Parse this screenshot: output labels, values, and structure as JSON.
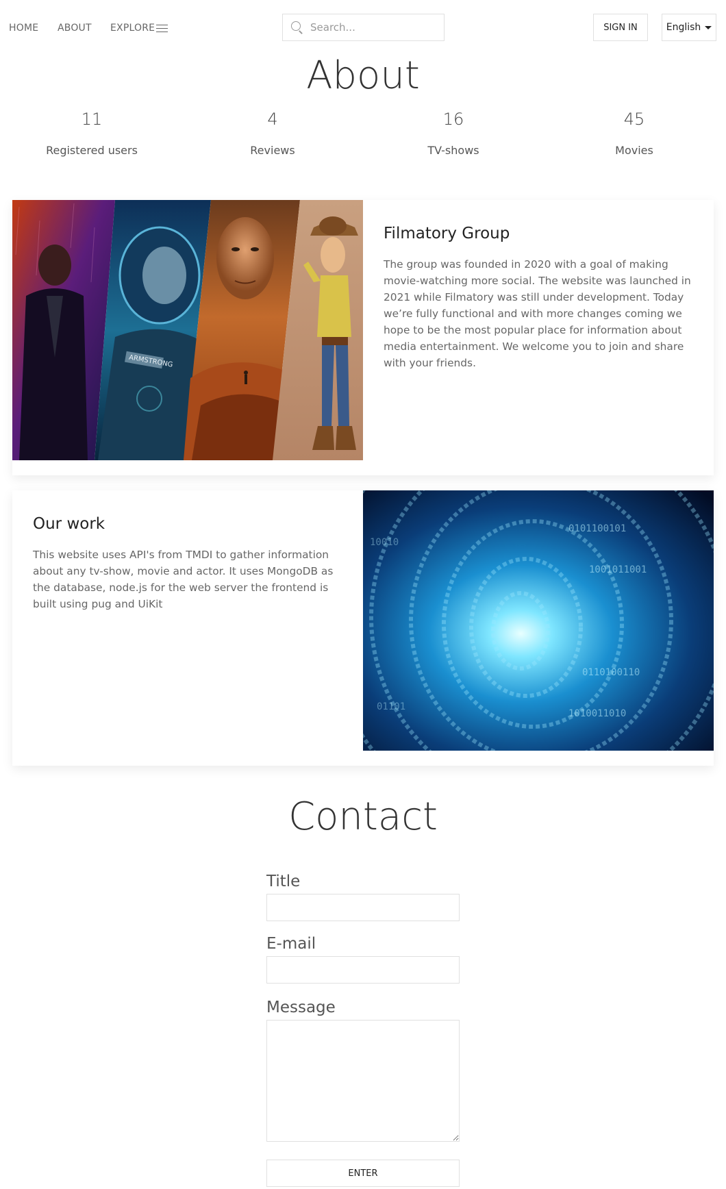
{
  "nav": {
    "home": "HOME",
    "about": "ABOUT",
    "explore": "EXPLORE",
    "search_placeholder": "Search...",
    "signin": "SIGN IN",
    "language": "English"
  },
  "about": {
    "title": "About",
    "stats": [
      {
        "value": "11",
        "label": "Registered users"
      },
      {
        "value": "4",
        "label": "Reviews"
      },
      {
        "value": "16",
        "label": "TV-shows"
      },
      {
        "value": "45",
        "label": "Movies"
      }
    ]
  },
  "cards": [
    {
      "title": "Filmatory Group",
      "body": "The group was founded in 2020 with a goal of making movie-watching more social. The website was launched in 2021 while Filmatory was still under development. Today we’re fully functional and with more changes coming we hope to be the most popular place for information about media entertainment. We welcome you to join and share with your friends.",
      "image_text": "ARMSTRONG"
    },
    {
      "title": "Our work",
      "body": "This website uses API's from TMDI to gather information about any tv-show, movie and actor. It uses MongoDB as the database, node.js for the web server the frontend is built using pug and UiKit"
    }
  ],
  "contact": {
    "title": "Contact",
    "title_label": "Title",
    "email_label": "E-mail",
    "message_label": "Message",
    "submit": "ENTER"
  },
  "colors": {
    "text_dark": "#222222",
    "text_muted": "#666666",
    "border": "#e0e0e0"
  }
}
